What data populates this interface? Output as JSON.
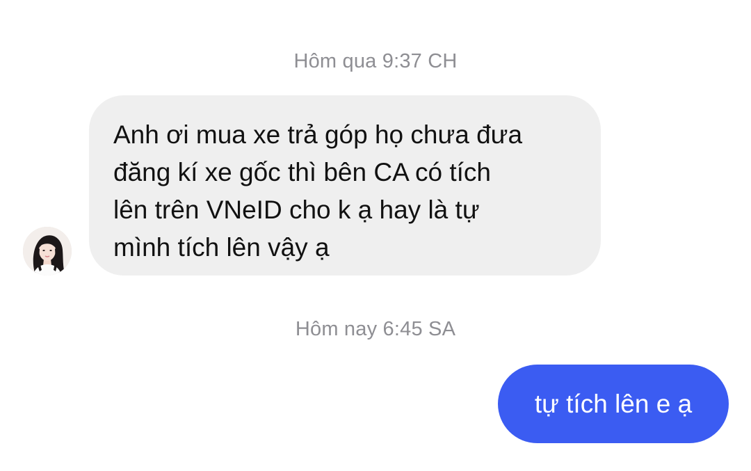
{
  "chat": {
    "messages": [
      {
        "timestamp": "Hôm qua 9:37 CH",
        "sender": "incoming",
        "avatar_icon": "user-avatar-photo",
        "text": "Anh ơi mua xe trả góp họ chưa đưa\nđăng kí xe gốc thì bên CA có tích\nlên trên VNeID cho k ạ hay là tự\nmình tích lên vậy ạ"
      },
      {
        "timestamp": "Hôm nay 6:45 SA",
        "sender": "outgoing",
        "text": "tự tích lên e ạ"
      }
    ]
  },
  "colors": {
    "background": "#ffffff",
    "timestamp": "#8e8e93",
    "incoming_bubble": "#efefef",
    "incoming_text": "#111111",
    "outgoing_bubble": "#3b5cf2",
    "outgoing_text": "#ffffff"
  }
}
